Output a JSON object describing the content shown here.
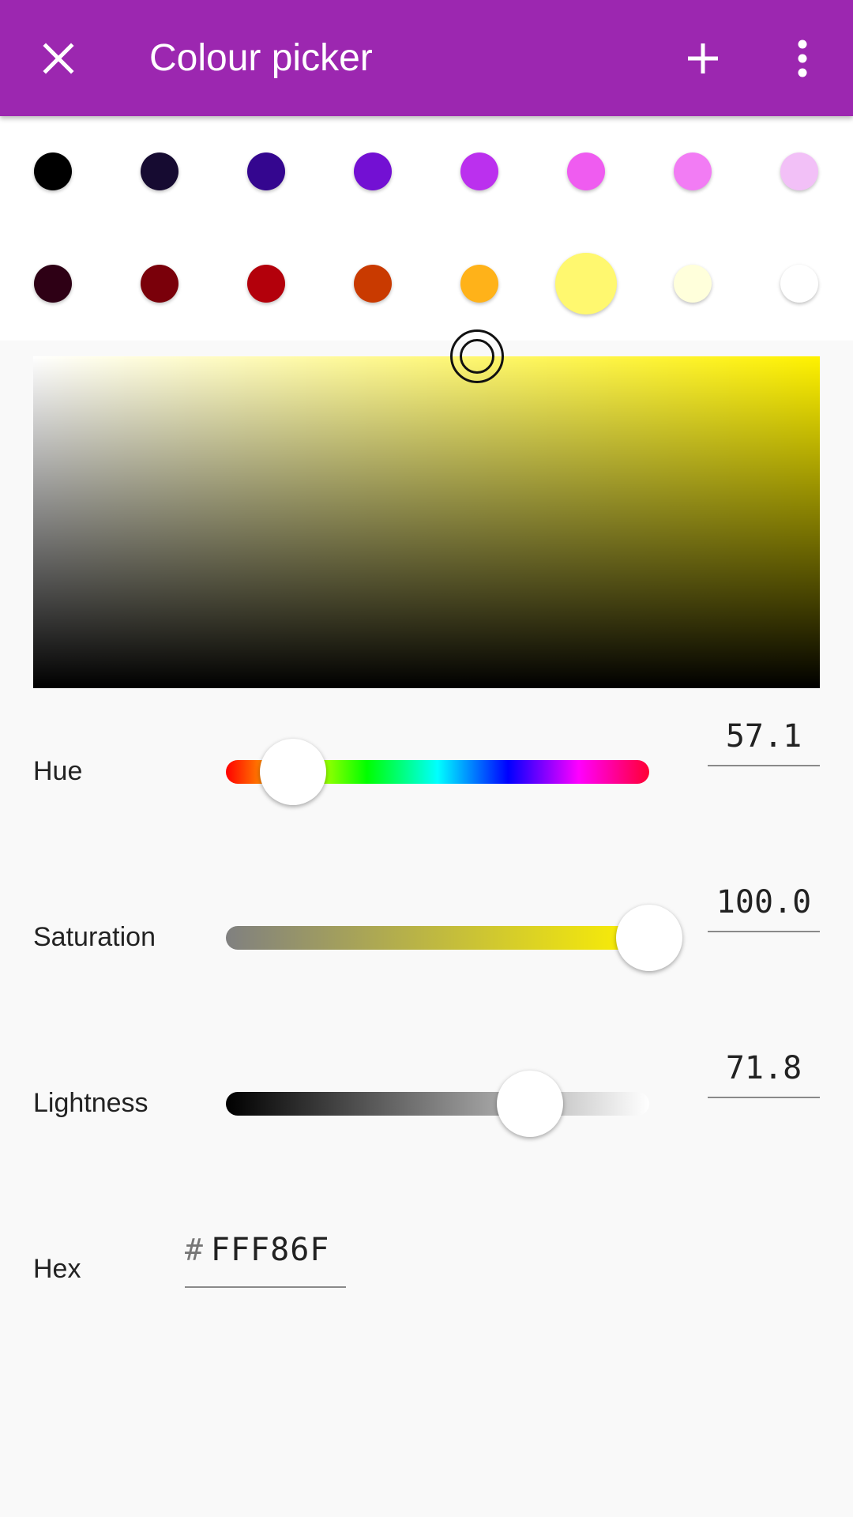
{
  "app_bar": {
    "title": "Colour picker",
    "background": "#9c27b0",
    "icons": [
      "close-icon",
      "add-icon",
      "more-vert-icon"
    ]
  },
  "swatches": {
    "row1": [
      "#000000",
      "#160b31",
      "#34068f",
      "#7310d3",
      "#bb30ee",
      "#ef5cf0",
      "#f27cf4",
      "#f2c0f7"
    ],
    "row2": [
      "#2e0015",
      "#7a000a",
      "#b3000b",
      "#c93a00",
      "#ffb219",
      "#fff86f",
      "#ffffdb",
      "#ffffff"
    ],
    "selected": "#fff86f"
  },
  "sliders": {
    "hue": {
      "label": "Hue",
      "value": "57.1",
      "fraction": 0.158
    },
    "saturation": {
      "label": "Saturation",
      "value": "100.0",
      "fraction": 1.0
    },
    "lightness": {
      "label": "Lightness",
      "value": "71.8",
      "fraction": 0.718
    }
  },
  "hex": {
    "label": "Hex",
    "prefix": "#",
    "value": "FFF86F"
  },
  "colors": {
    "pure_hue": "#fff200",
    "selected_color": "#fff86f"
  }
}
